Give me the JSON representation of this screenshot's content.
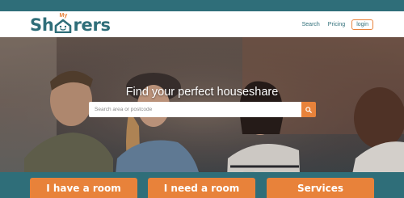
{
  "brand": {
    "logo_prefix": "Sh",
    "logo_suffix": "rers",
    "logo_superscript": "My",
    "color": "#2f6e79",
    "accent": "#e8823a"
  },
  "nav": {
    "search_label": "Search",
    "pricing_label": "Pricing",
    "login_label": "login"
  },
  "hero": {
    "title": "Find your perfect houseshare"
  },
  "search": {
    "placeholder": "Search area or postcode",
    "button_icon": "search-icon"
  },
  "cta": {
    "have_room": "I have a room",
    "need_room": "I need a room",
    "services": "Services"
  }
}
